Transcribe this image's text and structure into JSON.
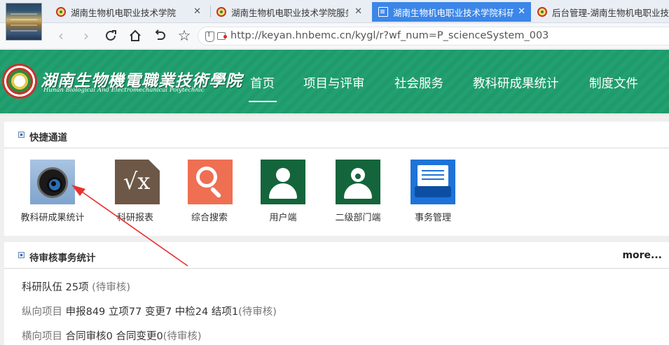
{
  "browser": {
    "tabs": [
      {
        "title": "湖南生物机电职业技术学院",
        "active": false
      },
      {
        "title": "湖南生物机电职业技术学院服务",
        "active": false
      },
      {
        "title": "湖南生物机电职业技术学院科研",
        "active": true
      },
      {
        "title": "后台管理-湖南生物机电职业技术",
        "active": false
      }
    ],
    "url": "http://keyan.hnbemc.cn/kygl/r?wf_num=P_scienceSystem_003",
    "icons": [
      "back-icon",
      "forward-icon",
      "refresh-icon",
      "home-icon",
      "undo-icon",
      "star-icon",
      "security-icon",
      "camera-blocked-icon"
    ]
  },
  "site": {
    "logo_cn": "湖南生物機電職業技術學院",
    "logo_en": "Hunan Biological And Electromechanical Polytechnic",
    "menu": [
      "首页",
      "项目与评审",
      "社会服务",
      "教科研成果统计",
      "制度文件"
    ],
    "active_menu": "首页",
    "colors": {
      "header_green": "#1f9b6b",
      "accent_red": "#e8322f"
    }
  },
  "quick": {
    "title": "快捷通道",
    "tiles": [
      {
        "label": "教科研成果统计",
        "icon": "lens-icon"
      },
      {
        "label": "科研报表",
        "icon": "sqrt-icon"
      },
      {
        "label": "综合搜索",
        "icon": "search-icon"
      },
      {
        "label": "用户端",
        "icon": "user-icon"
      },
      {
        "label": "二级部门端",
        "icon": "user-icon"
      },
      {
        "label": "事务管理",
        "icon": "printer-icon"
      }
    ]
  },
  "pending": {
    "title": "待审核事务统计",
    "more": "more...",
    "lines": [
      {
        "label": "科研队伍",
        "detail": "25项",
        "status": "(待审核)"
      },
      {
        "label": "纵向项目",
        "detail": "申报849 立项77 变更7 中检24 结项1",
        "status": "(待审核)"
      },
      {
        "label": "横向项目",
        "detail": "合同审核0 合同变更0",
        "status": "(待审核)"
      }
    ]
  }
}
